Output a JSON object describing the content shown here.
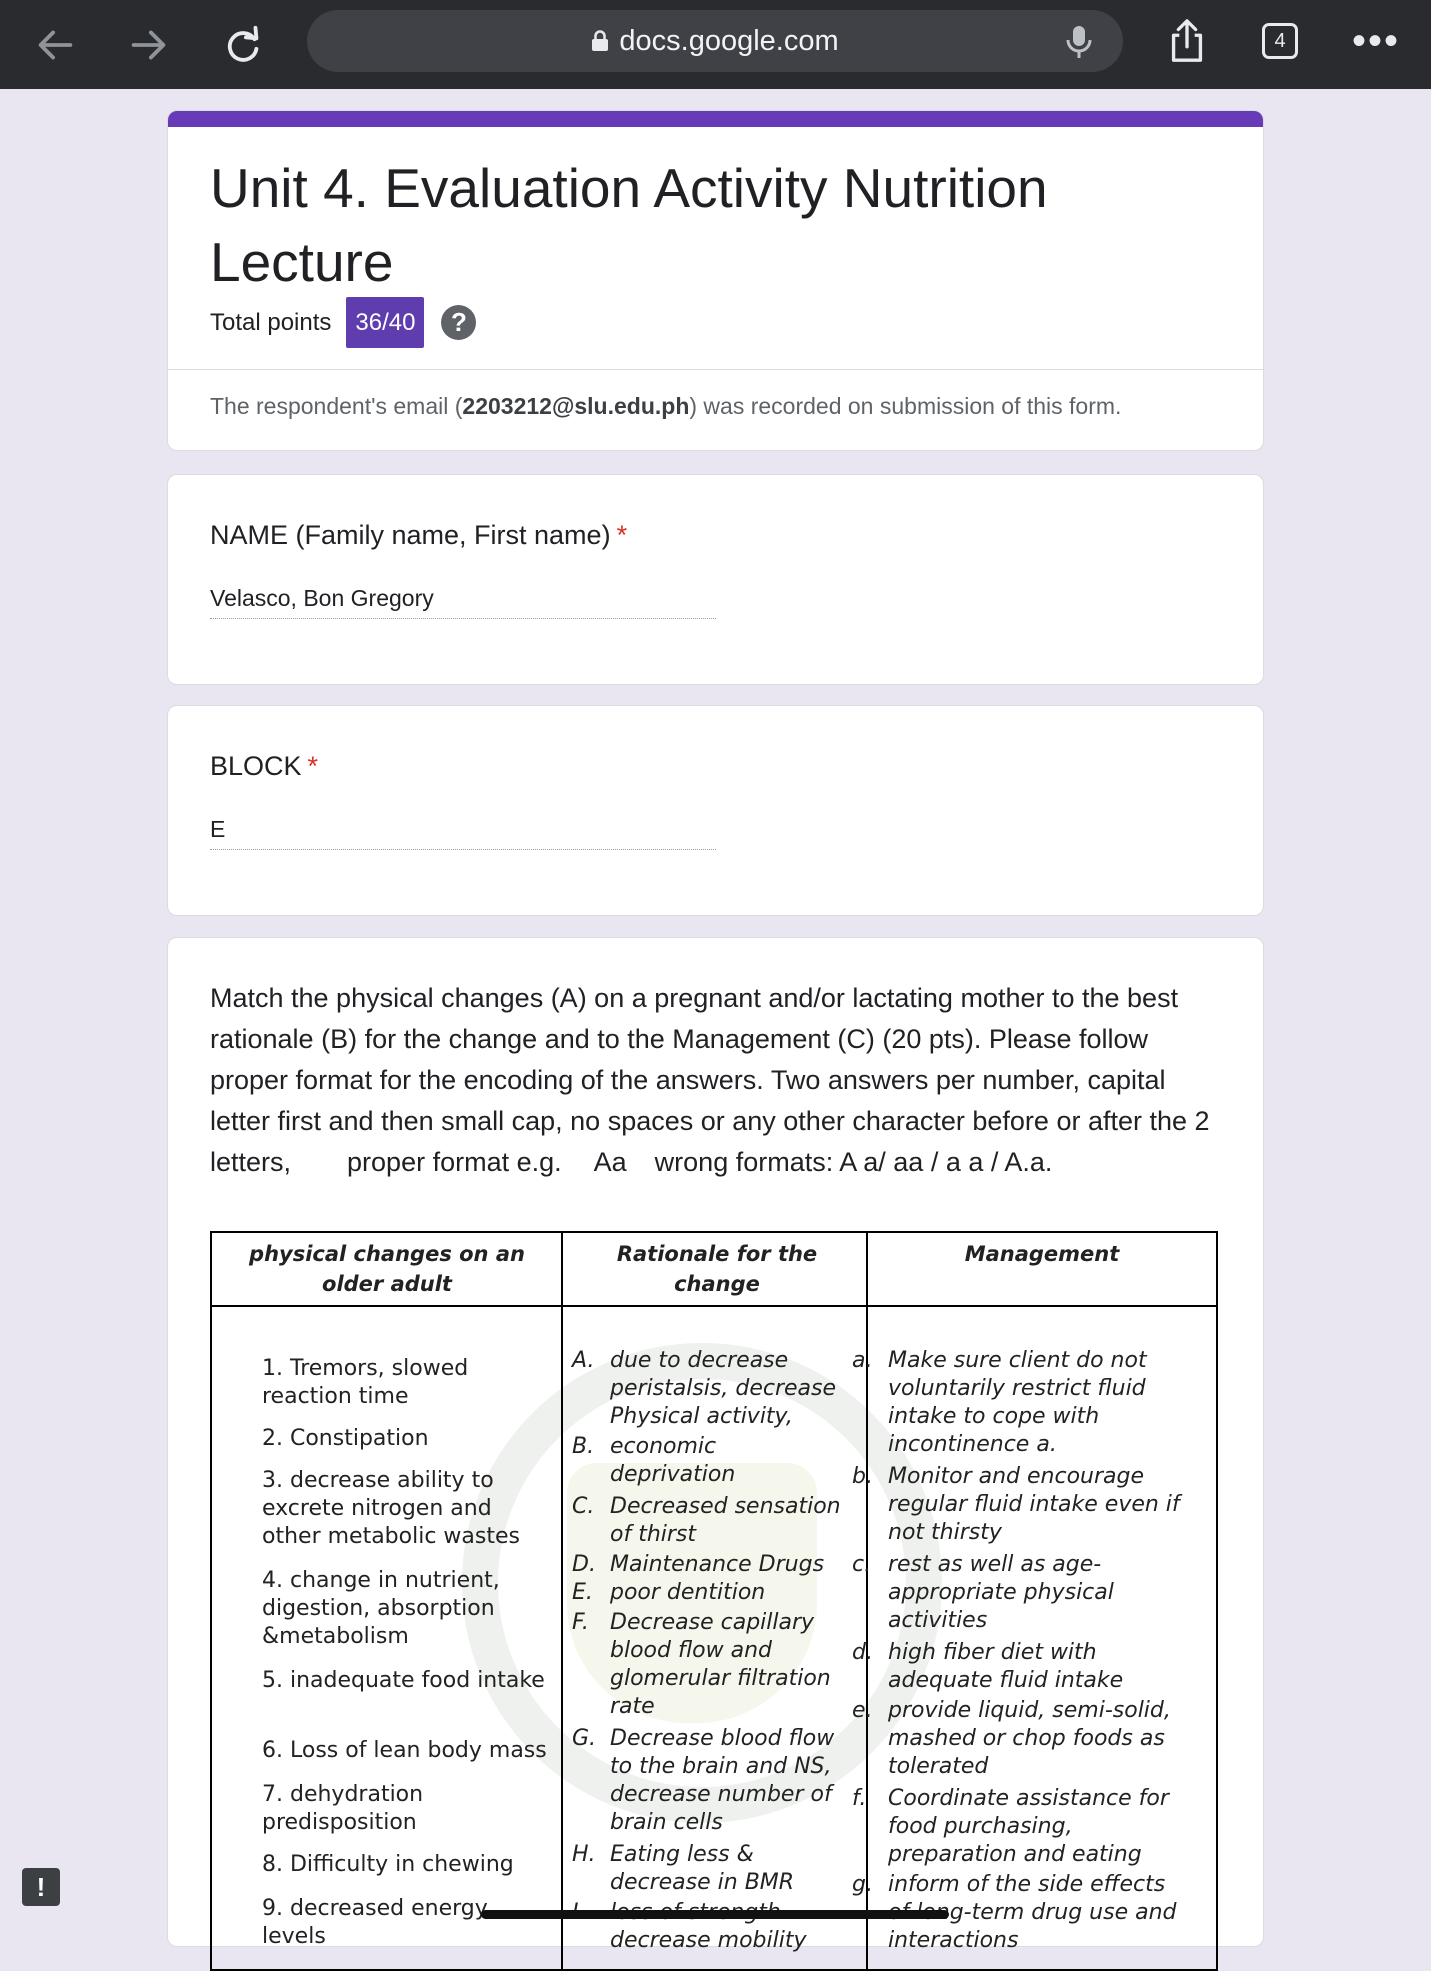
{
  "browser": {
    "url": "docs.google.com",
    "tab_count": "4",
    "more_label": "•••"
  },
  "form": {
    "title": "Unit 4. Evaluation Activity Nutrition Lecture",
    "total_points_label": "Total points",
    "score": "36/40",
    "help_label": "?",
    "email_prefix": "The respondent's email (",
    "email": "2203212@slu.edu.ph",
    "email_suffix": ") was recorded on submission of this form.",
    "accent_color": "#673ab7"
  },
  "questions": [
    {
      "label": "NAME (Family name, First name)",
      "required": "*",
      "answer": "Velasco, Bon Gregory"
    },
    {
      "label": "BLOCK",
      "required": "*",
      "answer": "E"
    }
  ],
  "match": {
    "instructions": "Match the physical changes (A) on a pregnant and/or  lactating mother to the best rationale (B) for the change and to the Management (C) (20 pts). Please follow proper format for the encoding of the answers.  Two answers per number, capital letter first and then small cap, no spaces or any other character before or after the 2 letters,",
    "format_label": "proper format  e.g.",
    "format_example": "Aa",
    "wrong_label": "wrong formats:  A a/ aa / a a / A.a.",
    "table": {
      "headers": [
        "physical changes on an older adult",
        "Rationale for the change",
        "Management"
      ],
      "physical_changes": [
        "1. Tremors, slowed reaction time",
        "2. Constipation",
        "3. decrease ability to excrete nitrogen and other metabolic wastes",
        "4. change in nutrient, digestion, absorption &metabolism",
        "5. inadequate food intake",
        "6. Loss of lean body mass",
        "7. dehydration predisposition",
        "8. Difficulty in chewing",
        "9. decreased energy levels"
      ],
      "rationales": [
        {
          "letter": "A.",
          "text": "due to decrease peristalsis, decrease Physical activity,"
        },
        {
          "letter": "B.",
          "text": "economic deprivation"
        },
        {
          "letter": "C.",
          "text": "Decreased sensation of thirst"
        },
        {
          "letter": "D.",
          "text": "Maintenance Drugs"
        },
        {
          "letter": "E.",
          "text": "poor dentition"
        },
        {
          "letter": "F.",
          "text": "Decrease capillary blood flow and glomerular filtration rate"
        },
        {
          "letter": "G.",
          "text": "Decrease blood flow to the brain and NS, decrease number of brain cells"
        },
        {
          "letter": "H.",
          "text": "Eating less & decrease in BMR"
        },
        {
          "letter": "I.",
          "text": "loss of strength- decrease mobility"
        }
      ],
      "management": [
        {
          "letter": "a.",
          "text": "Make sure client do not voluntarily restrict fluid intake to cope with incontinence a."
        },
        {
          "letter": "b.",
          "text": "Monitor and encourage regular fluid intake even if not thirsty"
        },
        {
          "letter": "c.",
          "text": "rest as well as age-appropriate physical activities"
        },
        {
          "letter": "d.",
          "text": "high fiber diet with adequate fluid intake"
        },
        {
          "letter": "e.",
          "text": "provide liquid, semi-solid, mashed or chop foods as tolerated"
        },
        {
          "letter": "f.",
          "text": "Coordinate assistance for food purchasing, preparation and eating"
        },
        {
          "letter": "g.",
          "text": "inform of the side effects of long-term drug use and interactions"
        }
      ]
    }
  },
  "report_label": "!"
}
